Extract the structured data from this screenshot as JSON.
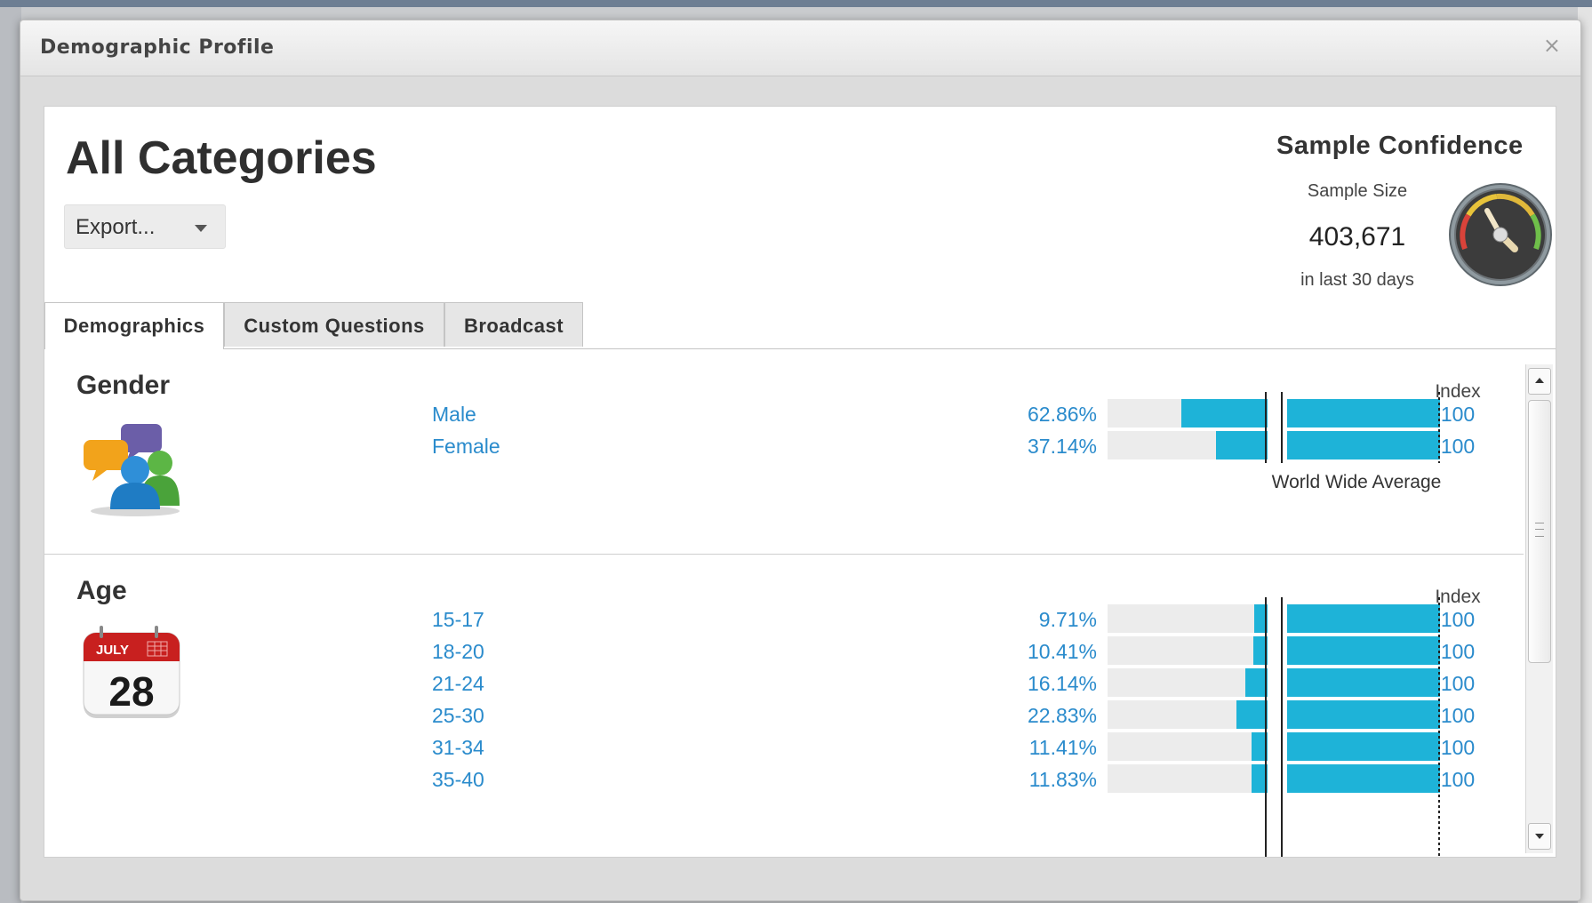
{
  "dialog": {
    "title": "Demographic Profile",
    "close_label": "×"
  },
  "header": {
    "title": "All Categories",
    "export_label": "Export..."
  },
  "confidence": {
    "title": "Sample Confidence",
    "sample_size_label": "Sample Size",
    "sample_size_value": "403,671",
    "period": "in last 30 days"
  },
  "tabs": [
    {
      "label": "Demographics",
      "active": true
    },
    {
      "label": "Custom Questions",
      "active": false
    },
    {
      "label": "Broadcast",
      "active": false
    }
  ],
  "gender": {
    "title": "Gender",
    "index_header": "Index",
    "avg_label": "World Wide Average",
    "rows": [
      {
        "label": "Male",
        "pct": "62.86%",
        "value": 62.86,
        "index": "100"
      },
      {
        "label": "Female",
        "pct": "37.14%",
        "value": 37.14,
        "index": "100"
      }
    ]
  },
  "age": {
    "title": "Age",
    "index_header": "Index",
    "calendar_month": "JULY",
    "calendar_day": "28",
    "rows": [
      {
        "label": "15-17",
        "pct": "9.71%",
        "value": 9.71,
        "index": "100"
      },
      {
        "label": "18-20",
        "pct": "10.41%",
        "value": 10.41,
        "index": "100"
      },
      {
        "label": "21-24",
        "pct": "16.14%",
        "value": 16.14,
        "index": "100"
      },
      {
        "label": "25-30",
        "pct": "22.83%",
        "value": 22.83,
        "index": "100"
      },
      {
        "label": "31-34",
        "pct": "11.41%",
        "value": 11.41,
        "index": "100"
      },
      {
        "label": "35-40",
        "pct": "11.83%",
        "value": 11.83,
        "index": "100"
      }
    ]
  },
  "colors": {
    "bar": "#1eb3d8",
    "link": "#2a8bcc",
    "track": "#ececec"
  }
}
